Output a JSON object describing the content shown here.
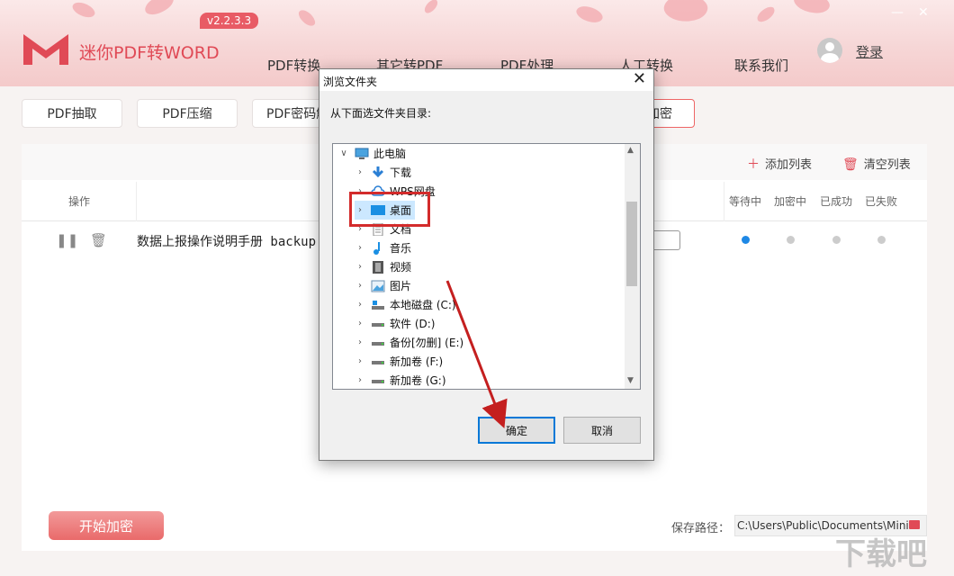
{
  "app": {
    "title": "迷你PDF转WORD",
    "version": "v2.2.3.3",
    "nav": [
      "PDF转换",
      "其它转PDF",
      "PDF处理",
      "人工转换",
      "联系我们"
    ],
    "login": "登录",
    "window_controls": [
      "—",
      "✕"
    ],
    "brand_color": "#e04a56"
  },
  "tools": [
    "PDF抽取",
    "PDF压缩",
    "PDF密码解",
    "加密"
  ],
  "list": {
    "add": "添加列表",
    "clear": "清空列表",
    "columns": {
      "op": "操作",
      "waiting": "等待中",
      "encrypting": "加密中",
      "success": "已成功",
      "failed": "已失败"
    },
    "row": {
      "name": "数据上报操作说明手册 backup"
    },
    "status_active": "waiting"
  },
  "footer": {
    "start": "开始加密",
    "save_label": "保存路径：",
    "save_path": "C:\\Users\\Public\\Documents\\Mini"
  },
  "watermark": "下载吧",
  "dialog": {
    "title": "浏览文件夹",
    "instruction": "从下面选文件夹目录:",
    "tree": [
      {
        "label": "此电脑",
        "icon": "pc-icon",
        "level": 0,
        "expanded": true
      },
      {
        "label": "下载",
        "icon": "download-icon",
        "level": 1
      },
      {
        "label": "WPS网盘",
        "icon": "cloud-icon",
        "level": 1
      },
      {
        "label": "桌面",
        "icon": "desktop-icon",
        "level": 1,
        "selected": true
      },
      {
        "label": "文档",
        "icon": "document-icon",
        "level": 1
      },
      {
        "label": "音乐",
        "icon": "music-icon",
        "level": 1
      },
      {
        "label": "视频",
        "icon": "video-icon",
        "level": 1
      },
      {
        "label": "图片",
        "icon": "picture-icon",
        "level": 1
      },
      {
        "label": "本地磁盘 (C:)",
        "icon": "drive-c-icon",
        "level": 1
      },
      {
        "label": "软件 (D:)",
        "icon": "drive-icon",
        "level": 1
      },
      {
        "label": "备份[勿删] (E:)",
        "icon": "drive-icon",
        "level": 1
      },
      {
        "label": "新加卷 (F:)",
        "icon": "drive-icon",
        "level": 1
      },
      {
        "label": "新加卷 (G:)",
        "icon": "drive-icon",
        "level": 1
      }
    ],
    "ok": "确定",
    "cancel": "取消",
    "close": "✕"
  }
}
